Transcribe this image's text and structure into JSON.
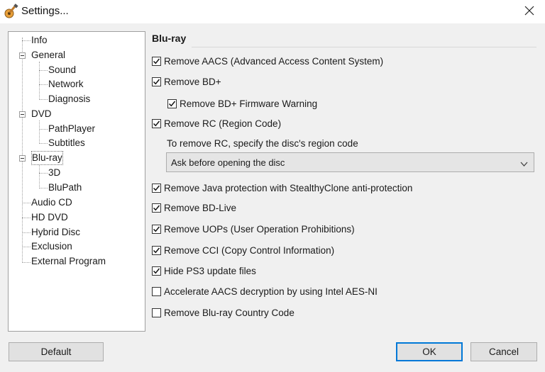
{
  "window": {
    "title": "Settings...",
    "icon": "app-guitar-icon",
    "close_icon": "close-icon"
  },
  "tree": {
    "items": [
      {
        "label": "Info"
      },
      {
        "label": "General"
      },
      {
        "label": "Sound"
      },
      {
        "label": "Network"
      },
      {
        "label": "Diagnosis"
      },
      {
        "label": "DVD"
      },
      {
        "label": "PathPlayer"
      },
      {
        "label": "Subtitles"
      },
      {
        "label": "Blu-ray"
      },
      {
        "label": "3D"
      },
      {
        "label": "BluPath"
      },
      {
        "label": "Audio CD"
      },
      {
        "label": "HD DVD"
      },
      {
        "label": "Hybrid Disc"
      },
      {
        "label": "Exclusion"
      },
      {
        "label": "External Program"
      }
    ],
    "selected": "Blu-ray"
  },
  "panel": {
    "title": "Blu-ray",
    "options": [
      {
        "label": "Remove AACS (Advanced Access Content System)",
        "checked": true
      },
      {
        "label": "Remove BD+",
        "checked": true
      },
      {
        "label": "Remove BD+ Firmware Warning",
        "checked": true
      },
      {
        "label": "Remove RC (Region Code)",
        "checked": true
      },
      {
        "label": "Remove Java protection with StealthyClone anti-protection",
        "checked": true
      },
      {
        "label": "Remove BD-Live",
        "checked": true
      },
      {
        "label": "Remove UOPs (User Operation Prohibitions)",
        "checked": true
      },
      {
        "label": "Remove CCI (Copy Control Information)",
        "checked": true
      },
      {
        "label": "Hide PS3 update files",
        "checked": true
      },
      {
        "label": "Accelerate AACS decryption by using Intel AES-NI",
        "checked": false
      },
      {
        "label": "Remove Blu-ray Country Code",
        "checked": false
      }
    ],
    "rc_hint": "To remove RC, specify the disc's region code",
    "rc_select_value": "Ask before opening the disc"
  },
  "buttons": {
    "default": "Default",
    "ok": "OK",
    "cancel": "Cancel"
  },
  "colors": {
    "accent": "#0078d7",
    "window_bg": "#f0f0f0"
  }
}
